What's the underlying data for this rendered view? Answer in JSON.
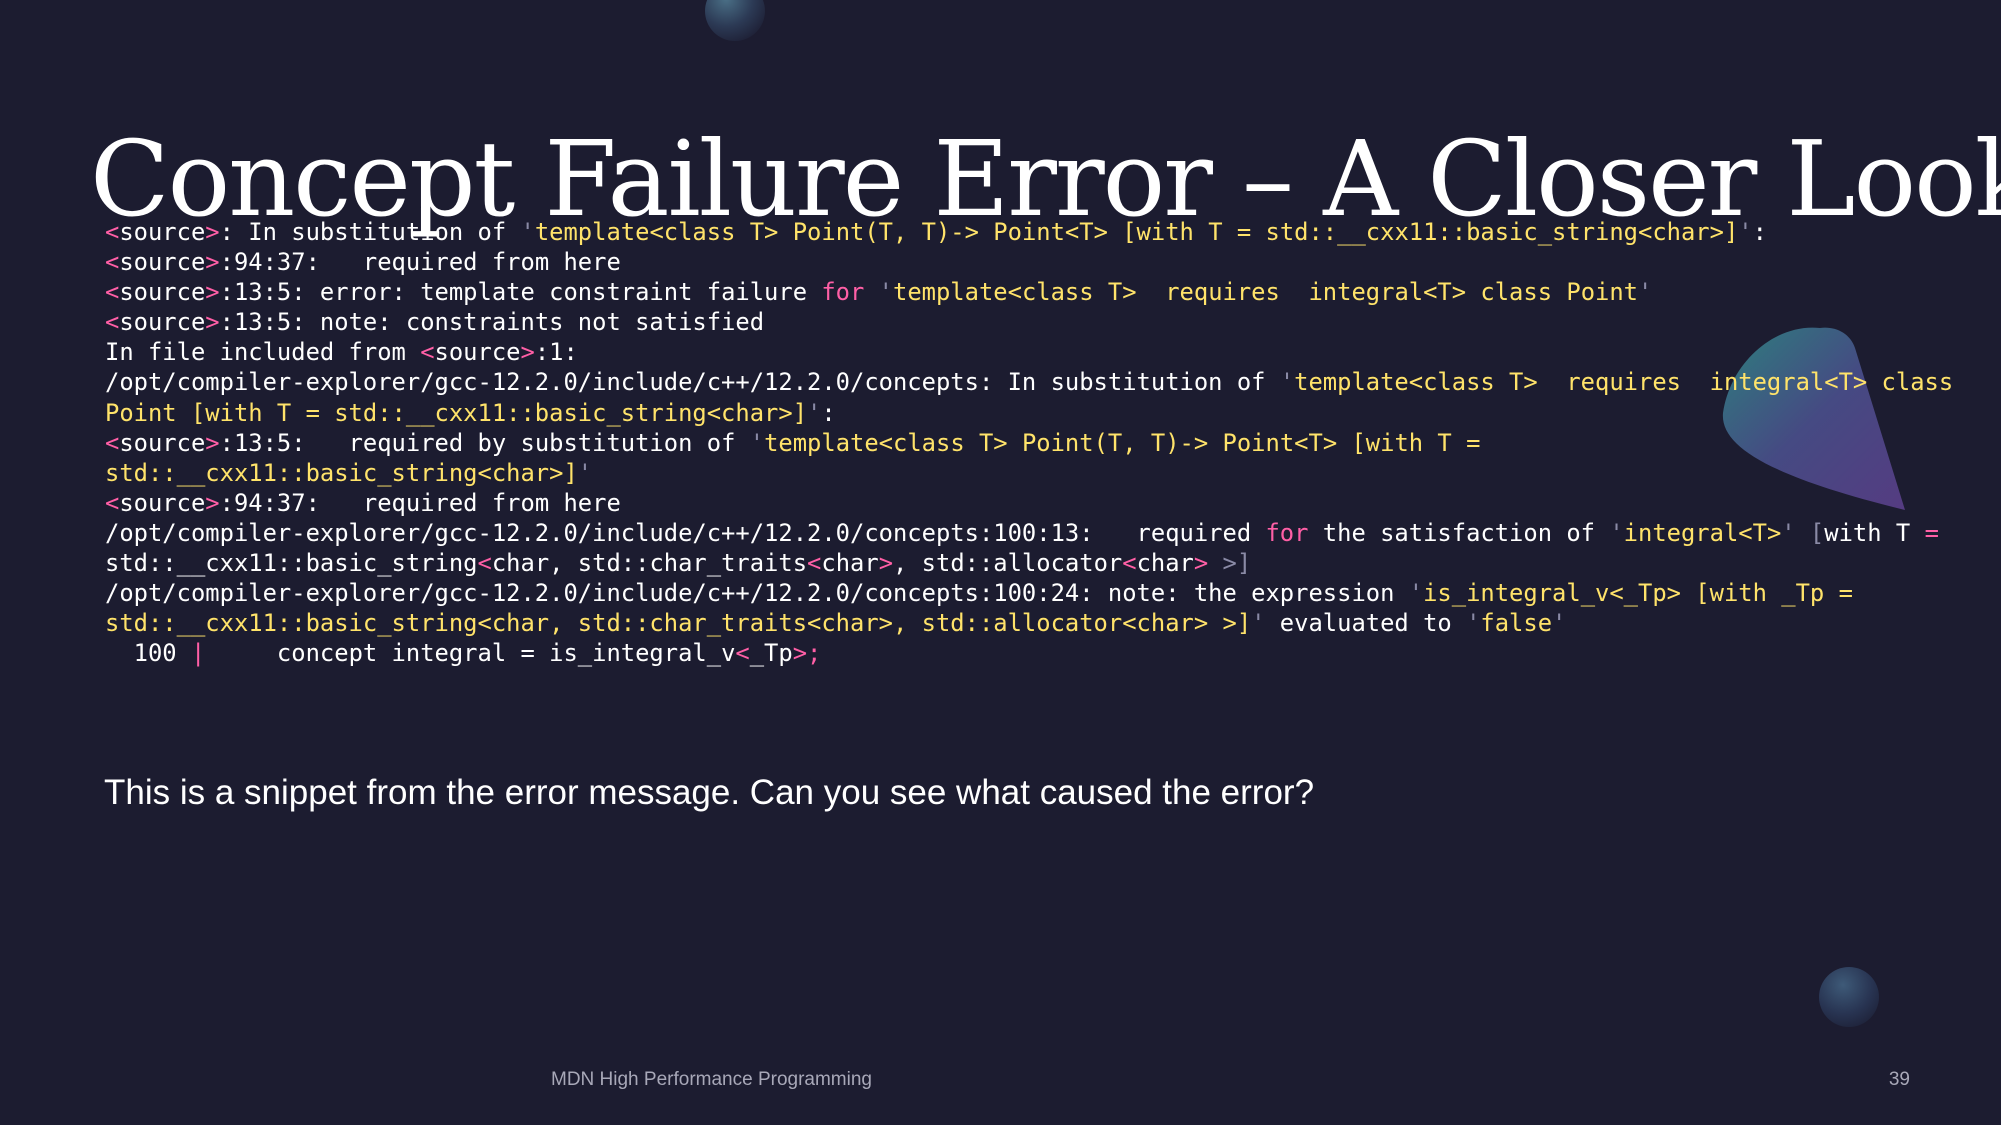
{
  "slide": {
    "title": "Concept Failure Error – A Closer Look",
    "caption": "This is a snippet from the error message. Can you see what caused the error?",
    "footer_text": "MDN High Performance Programming",
    "page_number": "39"
  },
  "colors": {
    "background": "#1c1c30",
    "code_text": "#ffffff",
    "string_highlight": "#ffe36a",
    "keyword_highlight": "#ff5fa6"
  },
  "error_log": {
    "lines": [
      [
        [
          "p",
          "<"
        ],
        [
          "w",
          "source"
        ],
        [
          "p",
          ">"
        ],
        [
          "w",
          ": In substitution of "
        ],
        [
          "g",
          "'"
        ],
        [
          "y",
          "template<class T> Point(T, T)-> Point<T> [with T = std::__cxx11::basic_string<char>]"
        ],
        [
          "g",
          "'"
        ],
        [
          "w",
          ":"
        ]
      ],
      [
        [
          "p",
          "<"
        ],
        [
          "w",
          "source"
        ],
        [
          "p",
          ">"
        ],
        [
          "w",
          ":94:37:   required from here"
        ]
      ],
      [
        [
          "p",
          "<"
        ],
        [
          "w",
          "source"
        ],
        [
          "p",
          ">"
        ],
        [
          "w",
          ":13:5: error: template constraint failure "
        ],
        [
          "p",
          "for"
        ],
        [
          "w",
          " "
        ],
        [
          "g",
          "'"
        ],
        [
          "y",
          "template<class T>  requires  integral<T> class Point"
        ],
        [
          "g",
          "'"
        ]
      ],
      [
        [
          "p",
          "<"
        ],
        [
          "w",
          "source"
        ],
        [
          "p",
          ">"
        ],
        [
          "w",
          ":13:5: note: constraints not satisfied"
        ]
      ],
      [
        [
          "w",
          "In file included from "
        ],
        [
          "p",
          "<"
        ],
        [
          "w",
          "source"
        ],
        [
          "p",
          ">"
        ],
        [
          "w",
          ":1:"
        ]
      ],
      [
        [
          "w",
          "/opt/compiler-explorer/gcc-12.2.0/include/c++/12.2.0/concepts: In substitution of "
        ],
        [
          "g",
          "'"
        ],
        [
          "y",
          "template<class T>  requires  integral<T> class"
        ]
      ],
      [
        [
          "y",
          "Point [with T = std::__cxx11::basic_string<char>]"
        ],
        [
          "g",
          "'"
        ],
        [
          "w",
          ":"
        ]
      ],
      [
        [
          "p",
          "<"
        ],
        [
          "w",
          "source"
        ],
        [
          "p",
          ">"
        ],
        [
          "w",
          ":13:5:   required by substitution of "
        ],
        [
          "g",
          "'"
        ],
        [
          "y",
          "template<class T> Point(T, T)-> Point<T> [with T ="
        ]
      ],
      [
        [
          "y",
          "std::__cxx11::basic_string<char>]"
        ],
        [
          "g",
          "'"
        ]
      ],
      [
        [
          "p",
          "<"
        ],
        [
          "w",
          "source"
        ],
        [
          "p",
          ">"
        ],
        [
          "w",
          ":94:37:   required from here"
        ]
      ],
      [
        [
          "w",
          "/opt/compiler-explorer/gcc-12.2.0/include/c++/12.2.0/concepts:100:13:   required "
        ],
        [
          "p",
          "for"
        ],
        [
          "w",
          " the satisfaction of "
        ],
        [
          "g",
          "'"
        ],
        [
          "y",
          "integral<T>"
        ],
        [
          "g",
          "' ["
        ],
        [
          "w",
          "with T "
        ],
        [
          "p",
          "="
        ]
      ],
      [
        [
          "w",
          "std::__cxx11::basic_string"
        ],
        [
          "p",
          "<"
        ],
        [
          "w",
          "char, std::char_traits"
        ],
        [
          "p",
          "<"
        ],
        [
          "w",
          "char"
        ],
        [
          "p",
          ">"
        ],
        [
          "w",
          ", std::allocator"
        ],
        [
          "p",
          "<"
        ],
        [
          "w",
          "char"
        ],
        [
          "p",
          "> "
        ],
        [
          "g",
          ">]"
        ]
      ],
      [
        [
          "w",
          "/opt/compiler-explorer/gcc-12.2.0/include/c++/12.2.0/concepts:100:24: note: the expression "
        ],
        [
          "g",
          "'"
        ],
        [
          "y",
          "is_integral_v<_Tp> [with _Tp ="
        ]
      ],
      [
        [
          "y",
          "std::__cxx11::basic_string<char, std::char_traits<char>, std::allocator<char> >]"
        ],
        [
          "g",
          "'"
        ],
        [
          "w",
          " evaluated to "
        ],
        [
          "g",
          "'"
        ],
        [
          "y",
          "false"
        ],
        [
          "g",
          "'"
        ]
      ],
      [
        [
          "w",
          "  100 "
        ],
        [
          "p",
          "|"
        ],
        [
          "w",
          "     concept integral = is_integral_v"
        ],
        [
          "p",
          "<"
        ],
        [
          "w",
          "_Tp"
        ],
        [
          "p",
          ">;"
        ]
      ]
    ]
  },
  "decorations": [
    "sphere-top",
    "cone-right",
    "sphere-bottom-right"
  ]
}
